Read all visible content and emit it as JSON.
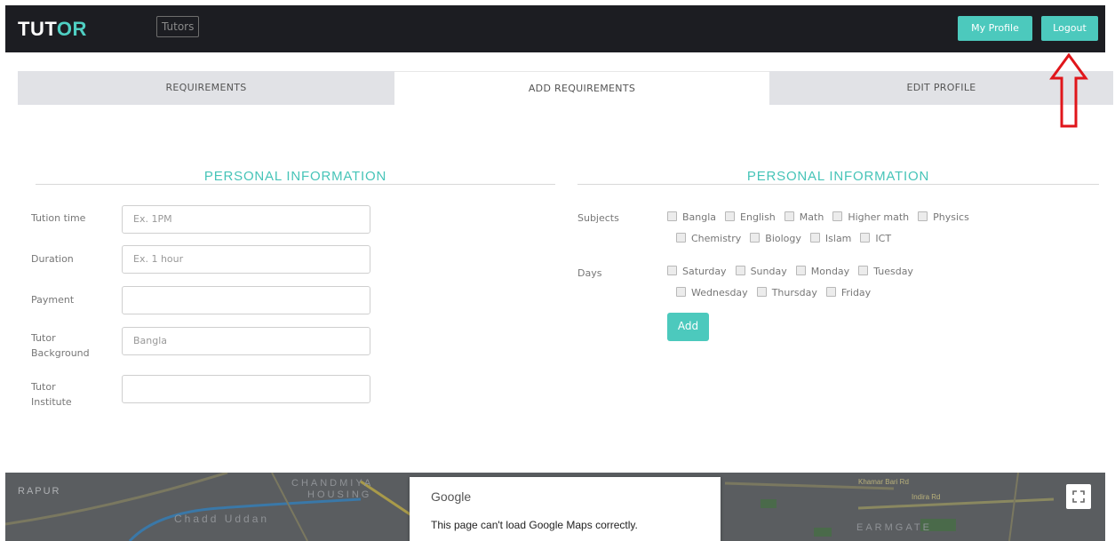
{
  "navbar": {
    "brand_part1": "TUT",
    "brand_part2": "OR",
    "tutors_link": "Tutors",
    "my_profile_label": "My Profile",
    "logout_label": "Logout"
  },
  "tabs": [
    {
      "label": "REQUIREMENTS"
    },
    {
      "label": "ADD REQUIREMENTS"
    },
    {
      "label": "EDIT PROFILE"
    }
  ],
  "left_section": {
    "title": "PERSONAL INFORMATION",
    "fields": [
      {
        "label": "Tution time",
        "placeholder": "Ex. 1PM",
        "value": ""
      },
      {
        "label": "Duration",
        "placeholder": "Ex. 1 hour",
        "value": ""
      },
      {
        "label": "Payment",
        "placeholder": "",
        "value": ""
      },
      {
        "label_line1": "Tutor",
        "label_line2": "Background",
        "placeholder": "Bangla",
        "value": ""
      },
      {
        "label_line1": "Tutor",
        "label_line2": "Institute",
        "placeholder": "",
        "value": ""
      }
    ]
  },
  "right_section": {
    "title": "PERSONAL INFORMATION",
    "subjects_label": "Subjects",
    "subjects_row1": [
      "Bangla",
      "English",
      "Math",
      "Higher math",
      "Physics"
    ],
    "subjects_row2": [
      "Chemistry",
      "Biology",
      "Islam",
      "ICT"
    ],
    "days_label": "Days",
    "days_row1": [
      "Saturday",
      "Sunday",
      "Monday",
      "Tuesday"
    ],
    "days_row2": [
      "Wednesday",
      "Thursday",
      "Friday"
    ],
    "add_label": "Add"
  },
  "map": {
    "labels": [
      "RAPUR",
      "CHANDMIYA",
      "HOUSING",
      "Chadd Uddan",
      "Khamar Bari Rd",
      "Indira Rd",
      "EARMGATE"
    ],
    "dialog_brand": "Google",
    "dialog_message": "This page can't load Google Maps correctly."
  },
  "colors": {
    "accent": "#4cc9bd",
    "navbar_bg": "#1c1d22",
    "tab_inactive_bg": "#e1e2e6",
    "annotation_red": "#e0161b"
  }
}
